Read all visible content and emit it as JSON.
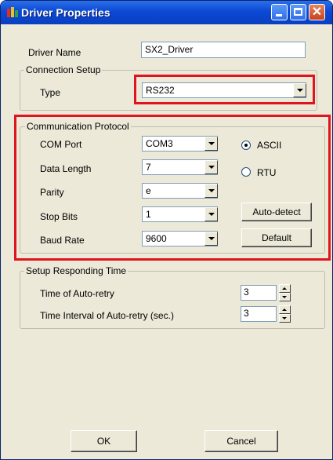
{
  "window": {
    "title": "Driver Properties",
    "title_color": "#0b49d5",
    "icon": "app-icon"
  },
  "driver": {
    "name_label": "Driver Name",
    "name_value": "SX2_Driver"
  },
  "connection": {
    "legend": "Connection Setup",
    "type_label": "Type",
    "type_value": "RS232"
  },
  "protocol": {
    "legend": "Communication Protocol",
    "fields": [
      {
        "label": "COM Port",
        "value": "COM3"
      },
      {
        "label": "Data Length",
        "value": "7"
      },
      {
        "label": "Parity",
        "value": "e"
      },
      {
        "label": "Stop Bits",
        "value": "1"
      },
      {
        "label": "Baud Rate",
        "value": "9600"
      }
    ],
    "mode_options": [
      {
        "label": "ASCII",
        "selected": true
      },
      {
        "label": "RTU",
        "selected": false
      }
    ],
    "autodetect_label": "Auto-detect",
    "default_label": "Default"
  },
  "responding": {
    "legend": "Setup Responding Time",
    "retry_label": "Time of Auto-retry",
    "retry_value": "3",
    "interval_label": "Time Interval of Auto-retry (sec.)",
    "interval_value": "3"
  },
  "footer": {
    "ok_label": "OK",
    "cancel_label": "Cancel"
  },
  "highlight_color": "#e0141e"
}
